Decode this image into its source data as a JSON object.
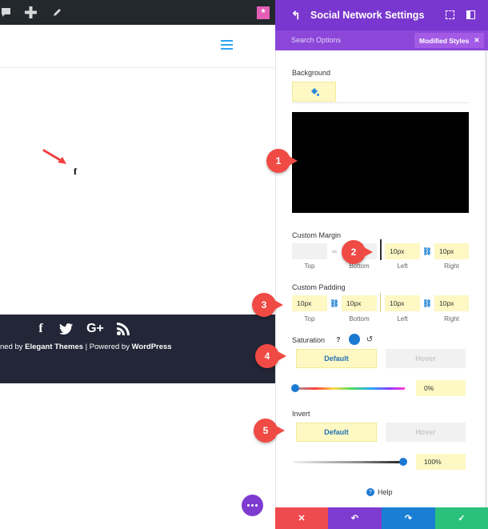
{
  "toolbar": {
    "icons": [
      "comment-icon",
      "plus-icon",
      "pencil-icon",
      "divi-star-icon"
    ]
  },
  "footer": {
    "social": [
      "f",
      "G+"
    ],
    "credits_prefix": "ned by ",
    "credits_brand": "Elegant Themes",
    "credits_mid": " | Powered by ",
    "credits_wp": "WordPress"
  },
  "sample": {
    "fb": "f"
  },
  "panel": {
    "title": "Social Network Settings",
    "search_options": "Search Options",
    "modified_styles": "Modified Styles",
    "background_label": "Background",
    "margin": {
      "label": "Custom Margin",
      "top_value": "",
      "bottom_value": "",
      "left_value": "10px",
      "right_value": "10px",
      "top_label": "Top",
      "bottom_label": "Bottom",
      "left_label": "Left",
      "right_label": "Right"
    },
    "padding": {
      "label": "Custom Padding",
      "top_value": "10px",
      "bottom_value": "10px",
      "left_value": "10px",
      "right_value": "10px",
      "top_label": "Top",
      "bottom_label": "Bottom",
      "left_label": "Left",
      "right_label": "Right"
    },
    "saturation": {
      "label": "Saturation",
      "default_tab": "Default",
      "hover_tab": "Hover",
      "value": "0%",
      "level": 0.0
    },
    "invert": {
      "label": "Invert",
      "default_tab": "Default",
      "hover_tab": "Hover",
      "value": "100%",
      "level": 1.0
    },
    "help": "Help"
  },
  "markers": [
    "1",
    "2",
    "3",
    "4",
    "5"
  ],
  "colors": {
    "purple": "#7a37cf",
    "cancel": "#ef4b4f",
    "undo": "#7e3bd0",
    "redo": "#1a7fd4",
    "save": "#29c17b",
    "marker": "#f04a45"
  }
}
